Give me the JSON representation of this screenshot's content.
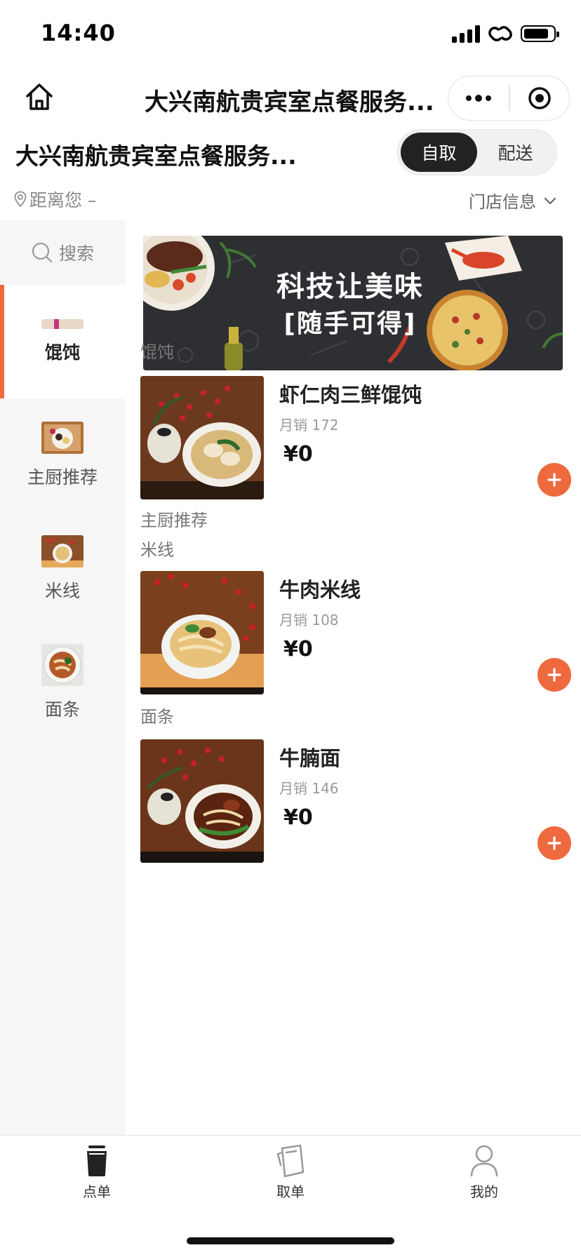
{
  "status_bar": {
    "time": "14:40"
  },
  "nav": {
    "title": "大兴南航贵宾室点餐服务..."
  },
  "store": {
    "name": "大兴南航贵宾室点餐服务...",
    "modes": [
      "自取",
      "配送"
    ],
    "active_mode": "自取",
    "distance": "距离您 –",
    "info_label": "门店信息"
  },
  "sidebar": {
    "search_label": "搜索",
    "categories": [
      {
        "label": "馄饨",
        "active": true
      },
      {
        "label": "主厨推荐",
        "active": false
      },
      {
        "label": "米线",
        "active": false
      },
      {
        "label": "面条",
        "active": false
      }
    ]
  },
  "banner": {
    "line1": "科技让美味",
    "line2": "[随手可得]"
  },
  "sections": [
    {
      "title": "馄饨",
      "items": [
        {
          "name": "虾仁肉三鲜馄饨",
          "sales": "月销 172",
          "price": "¥0"
        }
      ]
    },
    {
      "title": "主厨推荐",
      "items": []
    },
    {
      "title": "米线",
      "items": [
        {
          "name": "牛肉米线",
          "sales": "月销 108",
          "price": "¥0"
        }
      ]
    },
    {
      "title": "面条",
      "items": [
        {
          "name": "牛腩面",
          "sales": "月销 146",
          "price": "¥0"
        }
      ]
    }
  ],
  "tabbar": {
    "tabs": [
      "点单",
      "取单",
      "我的"
    ],
    "active": "点单"
  },
  "colors": {
    "accent": "#ee6a3e",
    "active_toggle": "#222222",
    "sidebar_bg": "#f6f6f6"
  }
}
